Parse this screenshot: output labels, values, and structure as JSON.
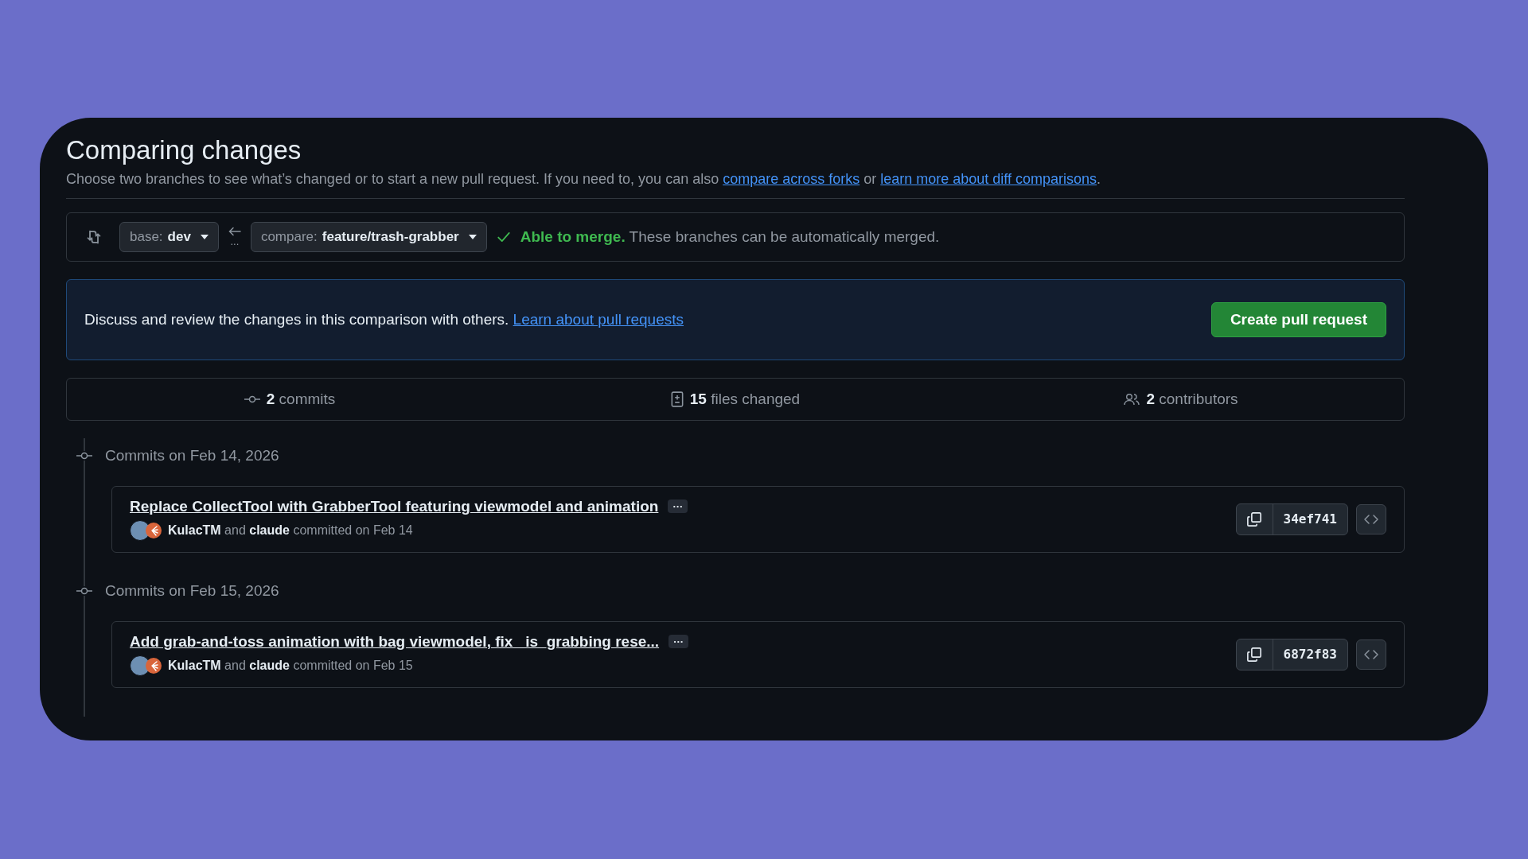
{
  "header": {
    "title": "Comparing changes",
    "intro": "Choose two branches to see what’s changed or to start a new pull request. If you need to, you can also",
    "link_forks": "compare across forks",
    "middle": "or",
    "link_diff": "learn more about diff comparisons",
    "end": "."
  },
  "branches": {
    "base_label": "base:",
    "base": "dev",
    "compare_label": "compare:",
    "compare": "feature/trash-grabber",
    "dots": "...",
    "merge": "**Able to merge.** These branches can be automatically merged."
  },
  "banner": {
    "text": "Discuss and review the changes in this comparison with others.",
    "link": "Learn about pull requests",
    "button": "Create pull request"
  },
  "stats": [
    {
      "kind": "commits",
      "count": "2",
      "label": "commits"
    },
    {
      "kind": "files",
      "count": "15",
      "label": "files changed"
    },
    {
      "kind": "contributors",
      "count": "2",
      "label": "contributors"
    }
  ],
  "groups": [
    {
      "heading": "Commits on Feb 14, 2026",
      "commits": [
        {
          "title": "Replace CollectTool with GrabberTool featuring viewmodel and animation",
          "more": "···",
          "meta": "**KulacTM** and **claude** committed on Feb 14",
          "sha": "34ef741"
        }
      ]
    },
    {
      "heading": "Commits on Feb 15, 2026",
      "commits": [
        {
          "title": "Add grab-and-toss animation with bag viewmodel, fix _is_grabbing rese...",
          "more": "···",
          "meta": "**KulacTM** and **claude** committed on Feb 15",
          "sha": "6872f83"
        }
      ]
    }
  ]
}
